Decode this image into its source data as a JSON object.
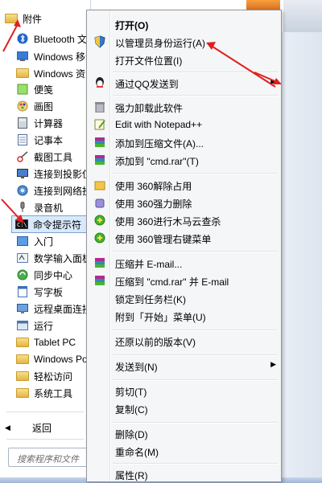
{
  "start_menu": {
    "items": [
      {
        "label": "附件",
        "icon": "folder-icon"
      },
      {
        "label": "Bluetooth 文件传送",
        "icon": "bluetooth-icon"
      },
      {
        "label": "Windows 移动中心",
        "icon": "windows-icon"
      },
      {
        "label": "Windows 资源管理器",
        "icon": "explorer-icon"
      },
      {
        "label": "便笺",
        "icon": "sticky-notes-icon"
      },
      {
        "label": "画图",
        "icon": "paint-icon"
      },
      {
        "label": "计算器",
        "icon": "calculator-icon"
      },
      {
        "label": "记事本",
        "icon": "notepad-icon"
      },
      {
        "label": "截图工具",
        "icon": "snipping-icon"
      },
      {
        "label": "连接到投影仪",
        "icon": "projector-icon"
      },
      {
        "label": "连接到网络投影仪",
        "icon": "network-projector-icon"
      },
      {
        "label": "录音机",
        "icon": "microphone-icon"
      },
      {
        "label": "命令提示符",
        "icon": "cmd-icon"
      },
      {
        "label": "入门",
        "icon": "getting-started-icon"
      },
      {
        "label": "数学输入面板",
        "icon": "math-input-icon"
      },
      {
        "label": "同步中心",
        "icon": "sync-icon"
      },
      {
        "label": "写字板",
        "icon": "wordpad-icon"
      },
      {
        "label": "远程桌面连接",
        "icon": "remote-desktop-icon"
      },
      {
        "label": "运行",
        "icon": "run-icon"
      },
      {
        "label": "Tablet PC",
        "icon": "folder-icon"
      },
      {
        "label": "Windows PowerShell",
        "icon": "folder-icon"
      },
      {
        "label": "轻松访问",
        "icon": "folder-icon"
      },
      {
        "label": "系统工具",
        "icon": "folder-icon"
      }
    ],
    "back_label": "返回",
    "search_placeholder": "搜索程序和文件"
  },
  "context_menu": {
    "items": [
      {
        "label": "打开(O)",
        "bold": true,
        "icon": ""
      },
      {
        "label": "以管理员身份运行(A)",
        "icon": "shield-icon"
      },
      {
        "label": "打开文件位置(I)",
        "icon": ""
      },
      {
        "label": "通过QQ发送到",
        "icon": "qq-icon",
        "submenu": true
      },
      {
        "label": "强力卸载此软件",
        "icon": "trash-icon"
      },
      {
        "label": "Edit with Notepad++",
        "icon": "notepad-plus-icon"
      },
      {
        "label": "添加到压缩文件(A)...",
        "icon": "winrar-icon"
      },
      {
        "label": "添加到 \"cmd.rar\"(T)",
        "icon": "winrar-icon"
      },
      {
        "label": "使用 360解除占用",
        "icon": "360-unlock-icon"
      },
      {
        "label": "使用 360强力删除",
        "icon": "360-delete-icon"
      },
      {
        "label": "使用 360进行木马云查杀",
        "icon": "360-scan-icon"
      },
      {
        "label": "使用 360管理右键菜单",
        "icon": "360-menu-icon"
      },
      {
        "label": "压缩并 E-mail...",
        "icon": "winrar-icon"
      },
      {
        "label": "压缩到 \"cmd.rar\" 并 E-mail",
        "icon": "winrar-icon"
      },
      {
        "label": "锁定到任务栏(K)",
        "icon": ""
      },
      {
        "label": "附到「开始」菜单(U)",
        "icon": ""
      },
      {
        "label": "还原以前的版本(V)",
        "icon": ""
      },
      {
        "label": "发送到(N)",
        "icon": "",
        "submenu": true
      },
      {
        "label": "剪切(T)",
        "icon": ""
      },
      {
        "label": "复制(C)",
        "icon": ""
      },
      {
        "label": "删除(D)",
        "icon": ""
      },
      {
        "label": "重命名(M)",
        "icon": ""
      },
      {
        "label": "属性(R)",
        "icon": ""
      }
    ]
  },
  "colors": {
    "arrow": "#e02020",
    "selection": "#d9e9fb"
  }
}
